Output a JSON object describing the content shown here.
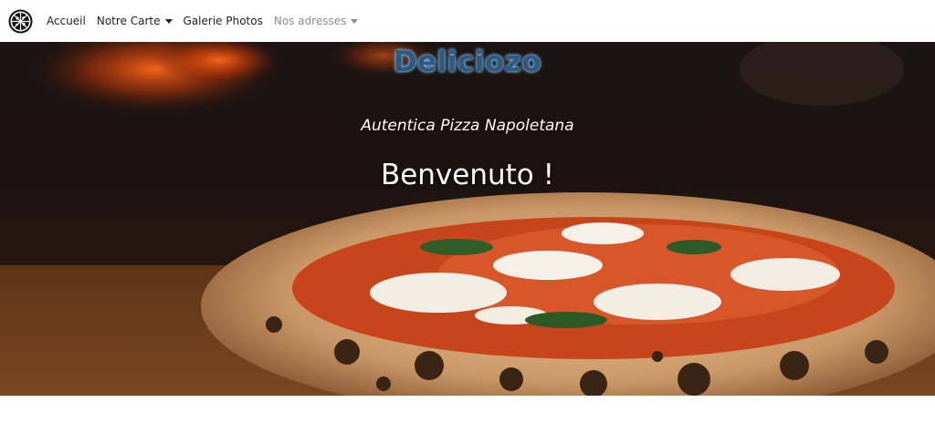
{
  "navbar": {
    "logo_icon": "pizza-icon",
    "items": [
      {
        "label": "Accueil",
        "dropdown": false,
        "muted": false
      },
      {
        "label": "Notre Carte",
        "dropdown": true,
        "muted": false
      },
      {
        "label": "Galerie Photos",
        "dropdown": false,
        "muted": false
      },
      {
        "label": "Nos adresses",
        "dropdown": true,
        "muted": true
      }
    ]
  },
  "hero": {
    "brand": "Deliciozo",
    "tagline": "Autentica Pizza Napoletana",
    "welcome": "Benvenuto !"
  },
  "colors": {
    "brand_text": "#2b5a86",
    "nav_text": "#222222",
    "nav_muted": "#8d8d8d"
  }
}
